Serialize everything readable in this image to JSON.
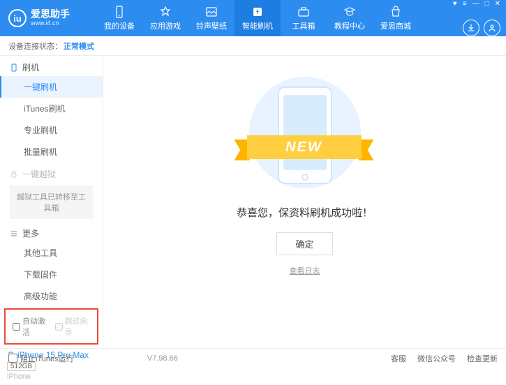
{
  "header": {
    "logo_title": "爱思助手",
    "logo_url": "www.i4.cn",
    "nav": [
      {
        "label": "我的设备"
      },
      {
        "label": "应用游戏"
      },
      {
        "label": "铃声壁纸"
      },
      {
        "label": "智能刷机"
      },
      {
        "label": "工具箱"
      },
      {
        "label": "教程中心"
      },
      {
        "label": "爱思商城"
      }
    ]
  },
  "status": {
    "label": "设备连接状态：",
    "value": "正常模式"
  },
  "sidebar": {
    "section_flash": "刷机",
    "items_flash": [
      "一键刷机",
      "iTunes刷机",
      "专业刷机",
      "批量刷机"
    ],
    "section_jailbreak": "一键越狱",
    "jailbreak_note": "越狱工具已转移至工具箱",
    "section_more": "更多",
    "items_more": [
      "其他工具",
      "下载固件",
      "高级功能"
    ],
    "chk_auto_activate": "自动激活",
    "chk_skip_guide": "跳过向导"
  },
  "device": {
    "name": "iPhone 15 Pro Max",
    "storage": "512GB",
    "type": "iPhone"
  },
  "main": {
    "banner_text": "NEW",
    "success": "恭喜您，保资料刷机成功啦！",
    "ok": "确定",
    "view_log": "查看日志"
  },
  "footer": {
    "block_itunes": "阻止iTunes运行",
    "version": "V7.98.66",
    "links": [
      "客服",
      "微信公众号",
      "检查更新"
    ]
  }
}
